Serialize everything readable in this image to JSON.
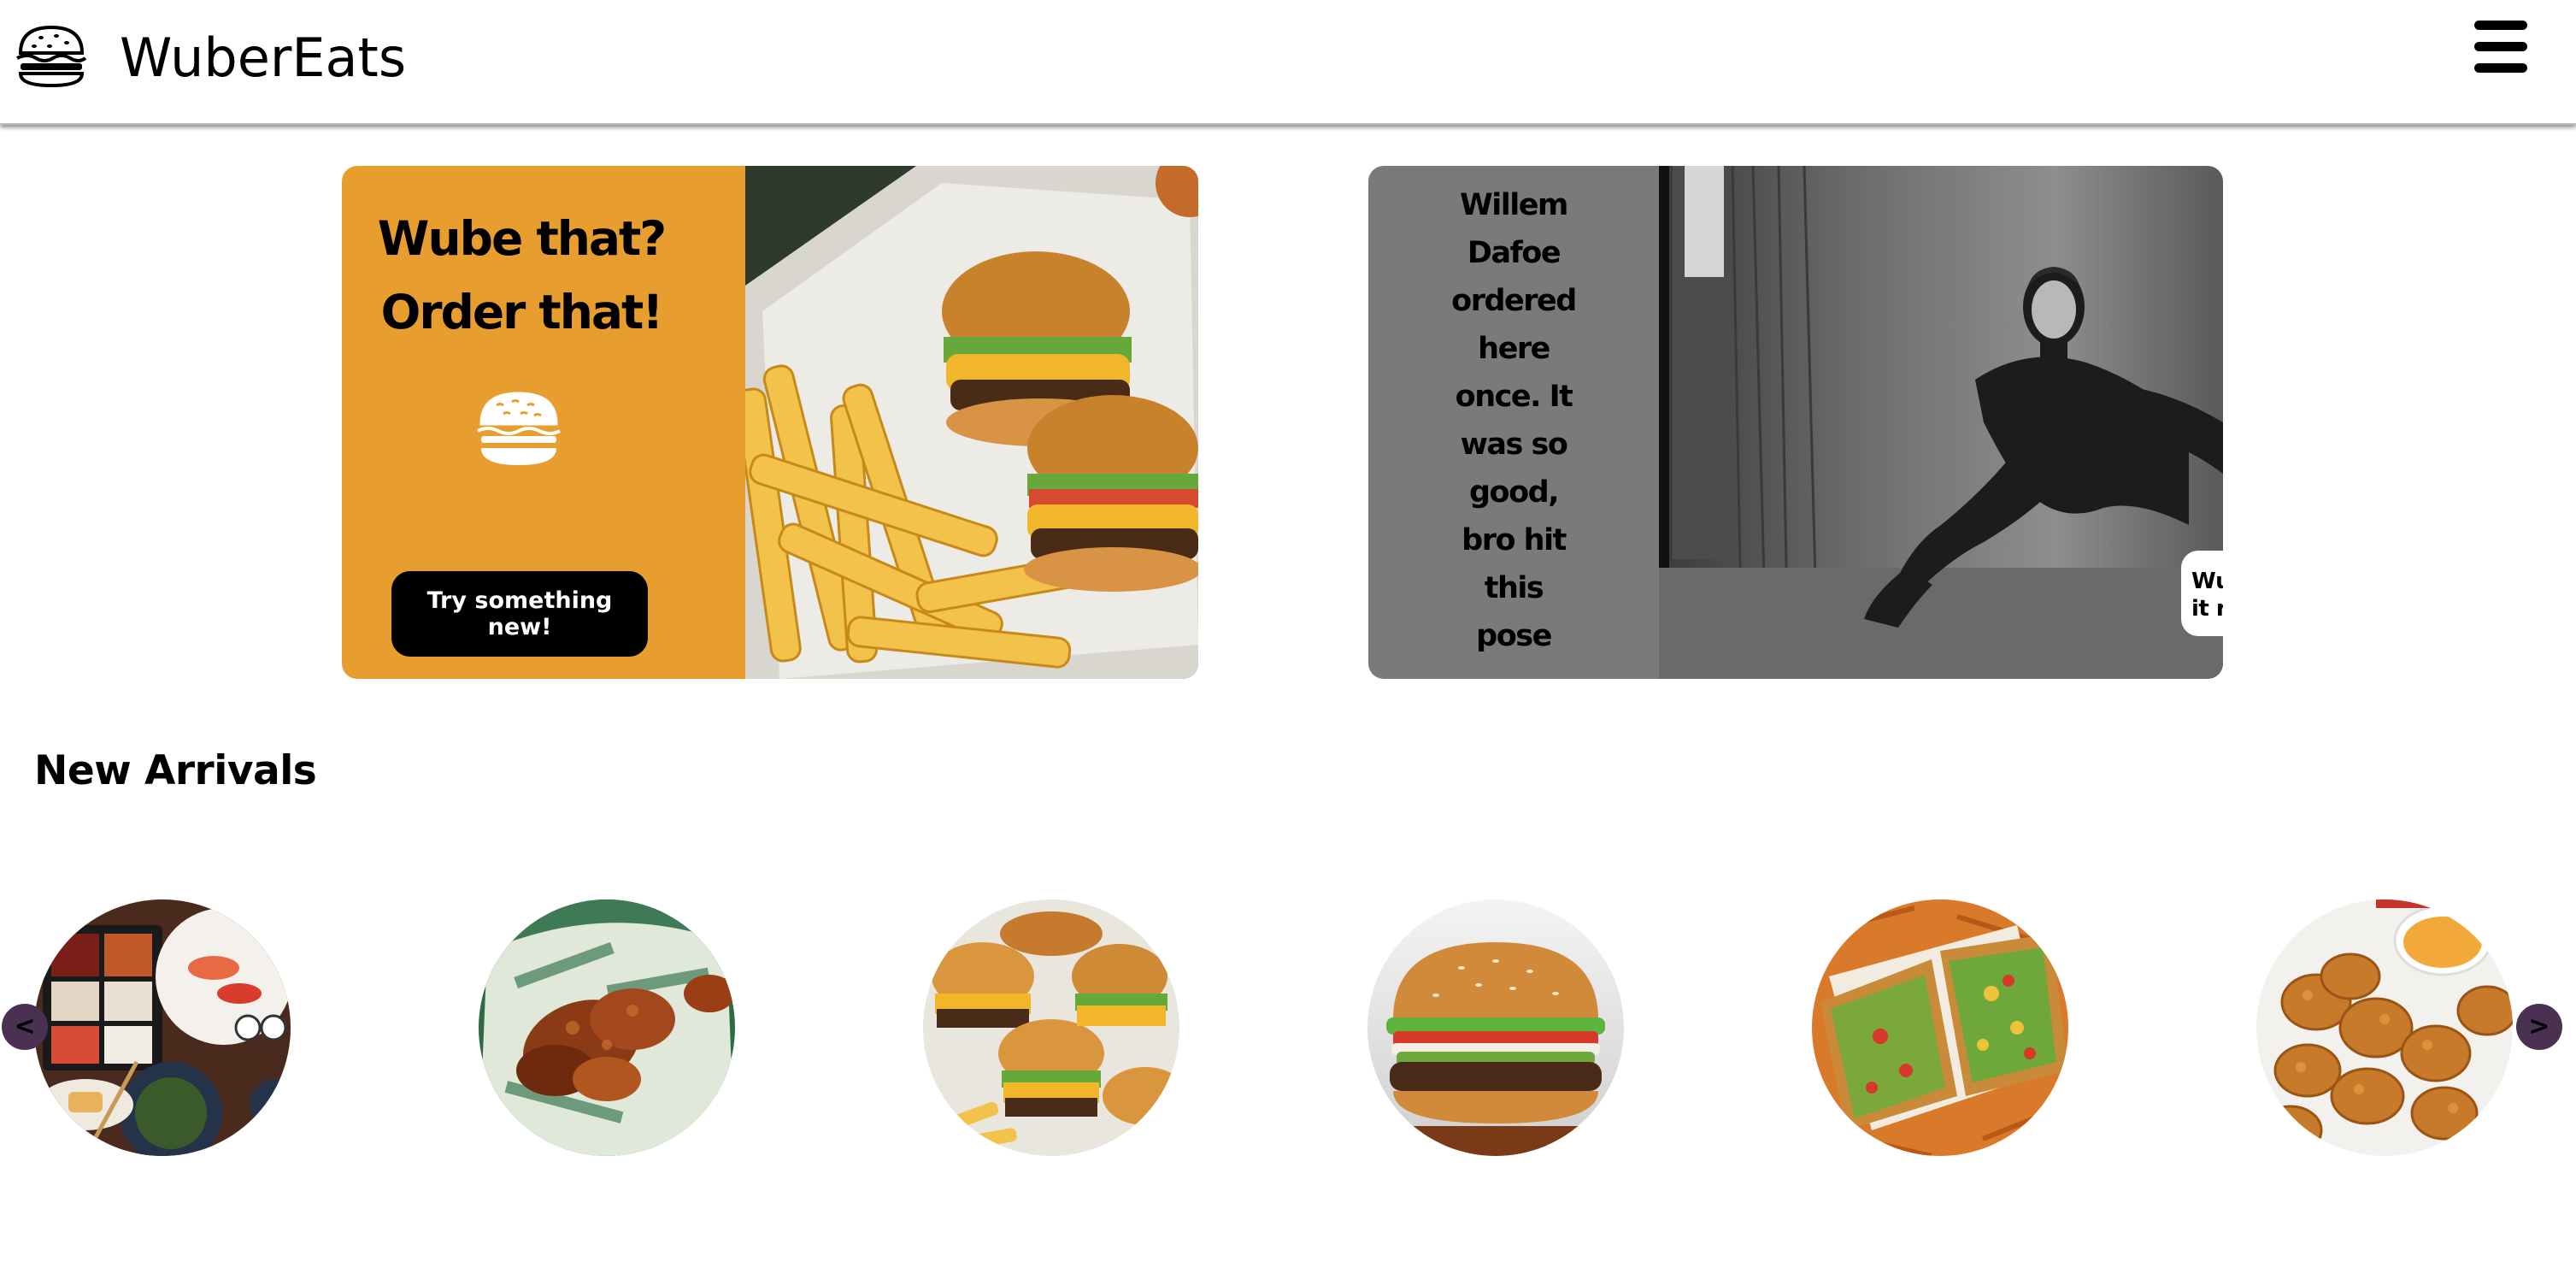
{
  "app": {
    "name": "WuberEats"
  },
  "header": {
    "logo_icon": "burger-icon",
    "menu_icon": "hamburger-menu-icon"
  },
  "promos": {
    "left": {
      "headline_line1": "Wube that?",
      "headline_line2": "Order that!",
      "icon": "burger-icon",
      "button_label": "Try something new!",
      "panel_color": "#e89e2f"
    },
    "right": {
      "lines": [
        "Willem",
        "Dafoe",
        "ordered",
        "here",
        "once. It",
        "was so",
        "good,",
        "bro hit",
        "this",
        "pose"
      ],
      "button_label": "Wube it now, Wube it real good",
      "button_icon": "arrow-right-icon",
      "panel_color": "#7a7a7a"
    }
  },
  "new_arrivals": {
    "title": "New Arrivals",
    "items": [
      {
        "image": "sushi-platter"
      },
      {
        "image": "chicken-wings"
      },
      {
        "image": "smash-burgers"
      },
      {
        "image": "whopper-burger"
      },
      {
        "image": "crunchwrap-fries"
      },
      {
        "image": "chicken-nuggets"
      }
    ],
    "prev_label": "<",
    "next_label": ">",
    "nav_color": "#4a3152"
  }
}
